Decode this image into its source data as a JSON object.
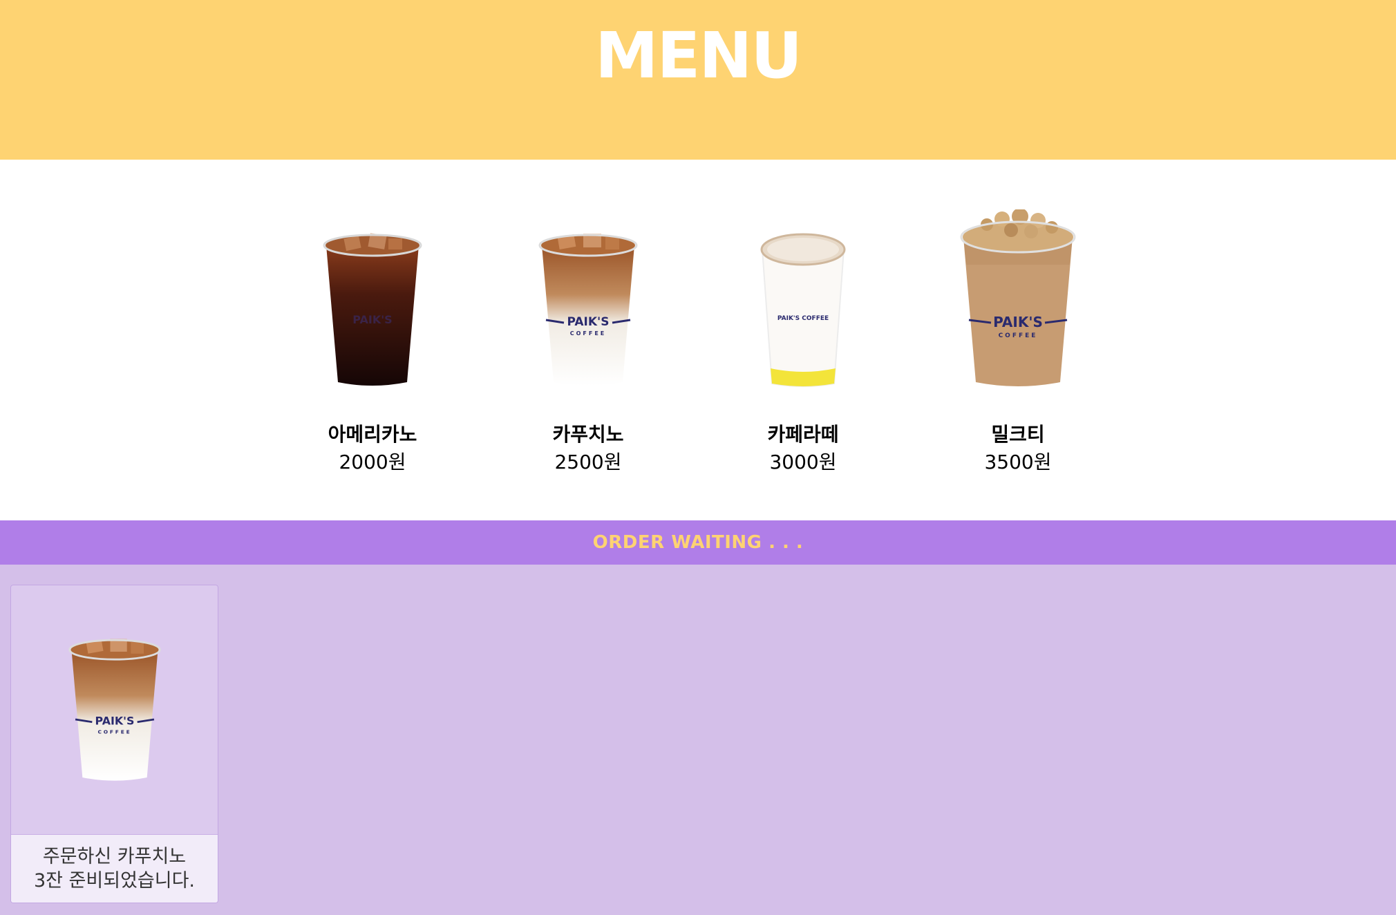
{
  "header": {
    "title": "MENU"
  },
  "menu": {
    "items": [
      {
        "name": "아메리카노",
        "price": "2000원",
        "icon": "iced-americano-cup-icon"
      },
      {
        "name": "카푸치노",
        "price": "2500원",
        "icon": "iced-cappuccino-cup-icon"
      },
      {
        "name": "카페라떼",
        "price": "3000원",
        "icon": "hot-latte-cup-icon"
      },
      {
        "name": "밀크티",
        "price": "3500원",
        "icon": "milk-tea-cup-icon"
      }
    ]
  },
  "order_status": {
    "label": "ORDER WAITING . . ."
  },
  "orders": [
    {
      "message_line1": "주문하신 카푸치노",
      "message_line2": "3잔 준비되었습니다.",
      "icon": "iced-cappuccino-cup-icon"
    }
  ],
  "colors": {
    "header_bg": "#fed372",
    "order_bar_bg": "#b07ee8",
    "order_bar_text": "#fed372",
    "queue_bg": "#d4bfe9",
    "card_text_bg": "#f2ecf9"
  }
}
